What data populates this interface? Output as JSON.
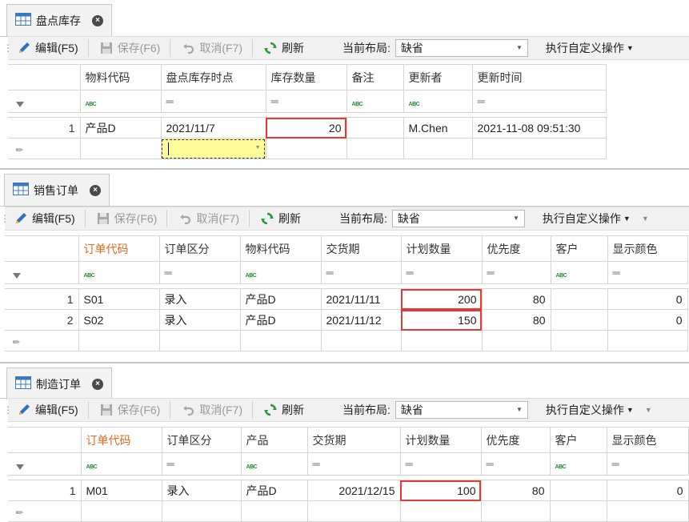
{
  "toolbar": {
    "edit_label": "编辑(F5)",
    "save_label": "保存(F6)",
    "cancel_label": "取消(F7)",
    "refresh_label": "刷新",
    "layout_label": "当前布局:",
    "layout_value": "缺省",
    "custom_ops_label": "执行自定义操作"
  },
  "panels": [
    {
      "tab": "盘点库存",
      "columns": [
        "物料代码",
        "盘点库存时点",
        "库存数量",
        "备注",
        "更新者",
        "更新时间"
      ],
      "filter": [
        "abc",
        "=",
        "=",
        "abc",
        "abc",
        "="
      ],
      "rows": [
        {
          "no": "1",
          "cells": [
            "产品D",
            "2021/11/7",
            "20",
            "",
            "M.Chen",
            "2021-11-08 09:51:30"
          ]
        }
      ]
    },
    {
      "tab": "销售订单",
      "columns": [
        "订单代码",
        "订单区分",
        "物料代码",
        "交货期",
        "计划数量",
        "优先度",
        "客户",
        "显示颜色"
      ],
      "filter": [
        "abc",
        "=",
        "abc",
        "=",
        "=",
        "=",
        "abc",
        "="
      ],
      "rows": [
        {
          "no": "1",
          "cells": [
            "S01",
            "录入",
            "产品D",
            "2021/11/11",
            "200",
            "80",
            "",
            "0"
          ]
        },
        {
          "no": "2",
          "cells": [
            "S02",
            "录入",
            "产品D",
            "2021/11/12",
            "150",
            "80",
            "",
            "0"
          ]
        }
      ]
    },
    {
      "tab": "制造订单",
      "columns": [
        "订单代码",
        "订单区分",
        "产品",
        "交货期",
        "计划数量",
        "优先度",
        "客户",
        "显示颜色"
      ],
      "filter": [
        "abc",
        "=",
        "abc",
        "=",
        "=",
        "=",
        "abc",
        "="
      ],
      "rows": [
        {
          "no": "1",
          "cells": [
            "M01",
            "录入",
            "产品D",
            "2021/12/15",
            "100",
            "80",
            "",
            "0"
          ]
        }
      ]
    }
  ],
  "icons": {
    "edit": "pencil-icon",
    "save": "floppy-icon",
    "cancel": "undo-icon",
    "refresh": "refresh-icon",
    "tab": "table-icon",
    "close": "close-icon",
    "filter": "filter-icon"
  },
  "colors": {
    "key_header": "#e06a1a",
    "highlight": "#e53935",
    "edit_cell": "#fffd9a"
  }
}
